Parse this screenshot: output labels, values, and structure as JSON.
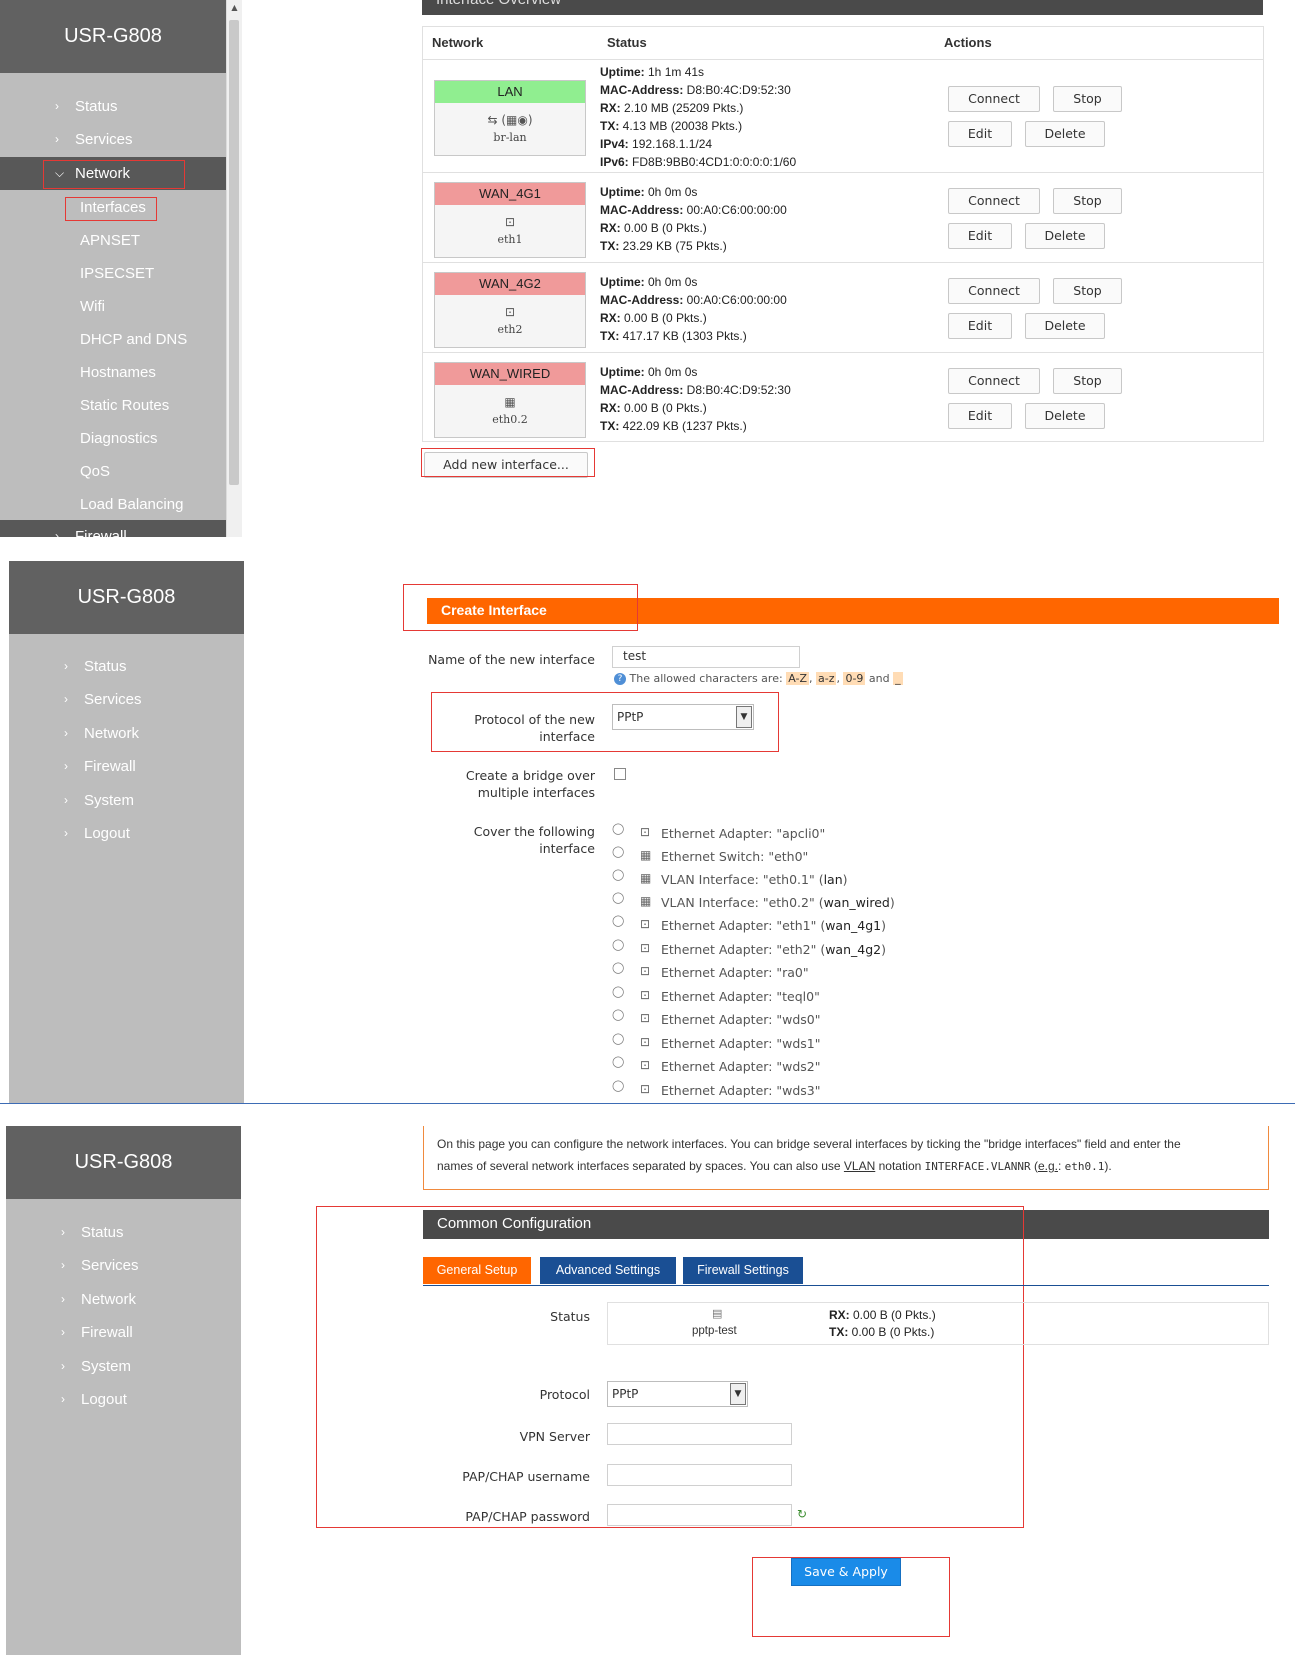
{
  "brand": "USR-G808",
  "colors": {
    "sidebar": "#bdbdbd",
    "brand_bg": "#616161",
    "accent_orange": "#ff6600",
    "header_dark": "#4a4a4a",
    "tab_blue": "#1a4f94",
    "highlight_red": "#e53935",
    "lan_green": "#90ee90",
    "wan_red": "#f09a9a",
    "save_blue": "#1a8be8"
  },
  "panel1": {
    "section_header": "Interface Overview",
    "nav": [
      {
        "label": "Status",
        "icon": "chevron-right-icon"
      },
      {
        "label": "Services",
        "icon": "chevron-right-icon"
      },
      {
        "label": "Network",
        "icon": "chevron-down-icon"
      }
    ],
    "subnav": [
      "Interfaces",
      "APNSET",
      "IPSECSET",
      "Wifi",
      "DHCP and DNS",
      "Hostnames",
      "Static Routes",
      "Diagnostics",
      "QoS",
      "Load Balancing"
    ],
    "nav_partial": "Firewall",
    "columns": {
      "network": "Network",
      "status": "Status",
      "actions": "Actions"
    },
    "interfaces": [
      {
        "name": "LAN",
        "color": "#90ee90",
        "icon": "bridge-icon",
        "device": "br-lan",
        "icon_glyph": "⇆ (▦◉)",
        "status": [
          {
            "k": "Uptime:",
            "v": " 1h 1m 41s"
          },
          {
            "k": "MAC-Address:",
            "v": " D8:B0:4C:D9:52:30"
          },
          {
            "k": "RX:",
            "v": " 2.10 MB (25209 Pkts.)"
          },
          {
            "k": "TX:",
            "v": " 4.13 MB (20038 Pkts.)"
          },
          {
            "k": "IPv4:",
            "v": " 192.168.1.1/24"
          },
          {
            "k": "IPv6:",
            "v": " FD8B:9BB0:4CD1:0:0:0:0:1/60"
          }
        ]
      },
      {
        "name": "WAN_4G1",
        "color": "#f09a9a",
        "icon": "ethernet-adapter-icon",
        "device": "eth1",
        "icon_glyph": "⊡",
        "status": [
          {
            "k": "Uptime:",
            "v": " 0h 0m 0s"
          },
          {
            "k": "MAC-Address:",
            "v": " 00:A0:C6:00:00:00"
          },
          {
            "k": "RX:",
            "v": " 0.00 B (0 Pkts.)"
          },
          {
            "k": "TX:",
            "v": " 23.29 KB (75 Pkts.)"
          }
        ]
      },
      {
        "name": "WAN_4G2",
        "color": "#f09a9a",
        "icon": "ethernet-adapter-icon",
        "device": "eth2",
        "icon_glyph": "⊡",
        "status": [
          {
            "k": "Uptime:",
            "v": " 0h 0m 0s"
          },
          {
            "k": "MAC-Address:",
            "v": " 00:A0:C6:00:00:00"
          },
          {
            "k": "RX:",
            "v": " 0.00 B (0 Pkts.)"
          },
          {
            "k": "TX:",
            "v": " 417.17 KB (1303 Pkts.)"
          }
        ]
      },
      {
        "name": "WAN_WIRED",
        "color": "#f09a9a",
        "icon": "ethernet-switch-icon",
        "device": "eth0.2",
        "icon_glyph": "▦",
        "status": [
          {
            "k": "Uptime:",
            "v": " 0h 0m 0s"
          },
          {
            "k": "MAC-Address:",
            "v": " D8:B0:4C:D9:52:30"
          },
          {
            "k": "RX:",
            "v": " 0.00 B (0 Pkts.)"
          },
          {
            "k": "TX:",
            "v": " 422.09 KB (1237 Pkts.)"
          }
        ]
      }
    ],
    "actions": {
      "connect": "Connect",
      "stop": "Stop",
      "edit": "Edit",
      "delete": "Delete"
    },
    "add_button": "Add new interface..."
  },
  "panel2": {
    "nav": [
      "Status",
      "Services",
      "Network",
      "Firewall",
      "System",
      "Logout"
    ],
    "title": "Create Interface",
    "name_label": "Name of the new interface",
    "name_value": "test",
    "hint_prefix": "The allowed characters are: ",
    "hint_a": "A-Z",
    "hint_sep1": ", ",
    "hint_b": "a-z",
    "hint_sep2": ", ",
    "hint_c": "0-9",
    "hint_and": " and ",
    "hint_d": "_",
    "protocol_label_1": "Protocol of the new",
    "protocol_label_2": "interface",
    "protocol_value": "PPtP",
    "bridge_label_1": "Create a bridge over",
    "bridge_label_2": "multiple interfaces",
    "cover_label_1": "Cover the following",
    "cover_label_2": "interface",
    "options": [
      {
        "text": "Ethernet Adapter: \"apcli0\"",
        "zone": "",
        "icon": "ethernet-adapter-icon",
        "glyph": "⊡"
      },
      {
        "text": "Ethernet Switch: \"eth0\"",
        "zone": "",
        "icon": "ethernet-switch-icon",
        "glyph": "▦"
      },
      {
        "text": "VLAN Interface: \"eth0.1\" (",
        "zone": "lan",
        "close": ")",
        "icon": "vlan-icon",
        "glyph": "▦"
      },
      {
        "text": "VLAN Interface: \"eth0.2\" (",
        "zone": "wan_wired",
        "close": ")",
        "icon": "vlan-icon",
        "glyph": "▦"
      },
      {
        "text": "Ethernet Adapter: \"eth1\" (",
        "zone": "wan_4g1",
        "close": ")",
        "icon": "ethernet-adapter-icon",
        "glyph": "⊡"
      },
      {
        "text": "Ethernet Adapter: \"eth2\" (",
        "zone": "wan_4g2",
        "close": ")",
        "icon": "ethernet-adapter-icon",
        "glyph": "⊡"
      },
      {
        "text": "Ethernet Adapter: \"ra0\"",
        "zone": "",
        "icon": "ethernet-adapter-icon",
        "glyph": "⊡"
      },
      {
        "text": "Ethernet Adapter: \"teql0\"",
        "zone": "",
        "icon": "ethernet-adapter-icon",
        "glyph": "⊡"
      },
      {
        "text": "Ethernet Adapter: \"wds0\"",
        "zone": "",
        "icon": "ethernet-adapter-icon",
        "glyph": "⊡"
      },
      {
        "text": "Ethernet Adapter: \"wds1\"",
        "zone": "",
        "icon": "ethernet-adapter-icon",
        "glyph": "⊡"
      },
      {
        "text": "Ethernet Adapter: \"wds2\"",
        "zone": "",
        "icon": "ethernet-adapter-icon",
        "glyph": "⊡"
      },
      {
        "text": "Ethernet Adapter: \"wds3\"",
        "zone": "",
        "icon": "ethernet-adapter-icon",
        "glyph": "⊡"
      }
    ]
  },
  "panel3": {
    "nav": [
      "Status",
      "Services",
      "Network",
      "Firewall",
      "System",
      "Logout"
    ],
    "info_1": "On this page you can configure the network interfaces. You can bridge several interfaces by ticking the \"bridge interfaces\" field and enter the",
    "info_2a": "names of several network interfaces separated by spaces. You can also use ",
    "info_vlan": "VLAN",
    "info_2b": " notation ",
    "info_code": "INTERFACE.VLANNR",
    "info_2c": " (",
    "info_eg": "e.g.",
    "info_2d": ": ",
    "info_code2": "eth0.1",
    "info_2e": ").",
    "section_title": "Common Configuration",
    "tabs": [
      "General Setup",
      "Advanced Settings",
      "Firewall Settings"
    ],
    "status_label": "Status",
    "status_device": "pptp-test",
    "rx_k": "RX:",
    "rx_v": " 0.00 B (0 Pkts.)",
    "tx_k": "TX:",
    "tx_v": " 0.00 B (0 Pkts.)",
    "protocol_label": "Protocol",
    "protocol_value": "PPtP",
    "vpn_label": "VPN Server",
    "user_label": "PAP/CHAP username",
    "pass_label": "PAP/CHAP password",
    "save_button": "Save & Apply"
  }
}
